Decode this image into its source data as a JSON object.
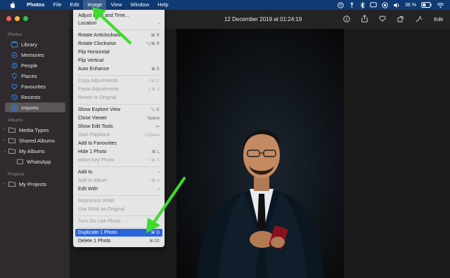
{
  "menubar": {
    "app": "Photos",
    "items": [
      "File",
      "Edit",
      "Image",
      "View",
      "Window",
      "Help"
    ],
    "battery": "36 %"
  },
  "sidebar": {
    "section_photos": "Photos",
    "items": [
      "Library",
      "Memories",
      "People",
      "Places",
      "Favourites",
      "Recents",
      "Imports"
    ],
    "section_albums": "Albums",
    "albums": [
      "Media Types",
      "Shared Albums",
      "My Albums",
      "WhatsApp"
    ],
    "section_projects": "Projects",
    "projects": [
      "My Projects"
    ]
  },
  "toolbar": {
    "title": "12 December 2019 at 01:24:19",
    "edit_label": "Edit"
  },
  "menu": {
    "items": [
      {
        "label": "Adjust Date and Time...",
        "shortcut": ""
      },
      {
        "label": "Location",
        "shortcut": "›"
      },
      {
        "label": "Rotate Anticlockwise",
        "shortcut": "⌘ R"
      },
      {
        "label": "Rotate Clockwise",
        "shortcut": "⌥⌘ R"
      },
      {
        "label": "Flip Horizontal",
        "shortcut": ""
      },
      {
        "label": "Flip Vertical",
        "shortcut": ""
      },
      {
        "label": "Auto Enhance",
        "shortcut": "⌘ E"
      },
      {
        "label": "Copy Adjustments",
        "shortcut": "⇧⌘ C"
      },
      {
        "label": "Paste Adjustments",
        "shortcut": "⇧⌘ V"
      },
      {
        "label": "Revert to Original",
        "shortcut": ""
      },
      {
        "label": "Show Explore View",
        "shortcut": "⌥ E"
      },
      {
        "label": "Close Viewer",
        "shortcut": "Space"
      },
      {
        "label": "Show Edit Tools",
        "shortcut": "↩"
      },
      {
        "label": "Start Playback",
        "shortcut": "⌥Space"
      },
      {
        "label": "Add to Favourites",
        "shortcut": "."
      },
      {
        "label": "Hide 1 Photo",
        "shortcut": "⌘ L"
      },
      {
        "label": "Make Key Photo",
        "shortcut": "⇧⌘ K"
      },
      {
        "label": "Add to",
        "shortcut": "›"
      },
      {
        "label": "Add to Album",
        "shortcut": "^⌘ A"
      },
      {
        "label": "Edit With",
        "shortcut": "›"
      },
      {
        "label": "Reprocess RAW",
        "shortcut": ""
      },
      {
        "label": "Use RAW as Original",
        "shortcut": ""
      },
      {
        "label": "Turn On Live Photo",
        "shortcut": ""
      },
      {
        "label": "Duplicate 1 Photo",
        "shortcut": "⌘ D"
      },
      {
        "label": "Delete 1 Photo",
        "shortcut": "⌘⌫"
      }
    ]
  },
  "colors": {
    "menubar": "#0f3a73",
    "highlight": "#2a63d9",
    "arrow": "#3ddc2a"
  }
}
